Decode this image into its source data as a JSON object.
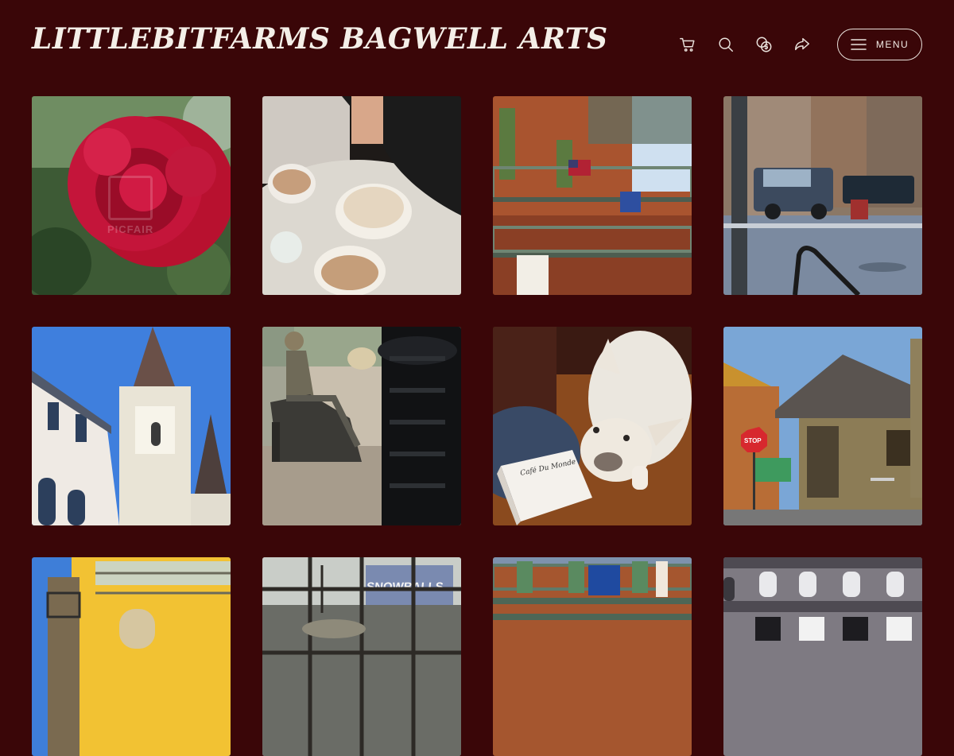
{
  "header": {
    "site_title": "LittleBitFarms Bagwell Arts",
    "menu_label": "MENU",
    "icons": [
      "cart-icon",
      "search-icon",
      "currency-icon",
      "share-icon",
      "hamburger-icon"
    ]
  },
  "colors": {
    "background": "#3a0608",
    "text": "#f4efe8"
  },
  "gallery": {
    "items": [
      {
        "subject": "red-rose",
        "watermark": "PICFAIR"
      },
      {
        "subject": "cafe-beignets"
      },
      {
        "subject": "balcony-flags"
      },
      {
        "subject": "street-truck"
      },
      {
        "subject": "cathedral-spire"
      },
      {
        "subject": "statue-bench"
      },
      {
        "subject": "bulldog-box",
        "box_text": "Café Du Monde"
      },
      {
        "subject": "corner-building",
        "sign_text": "STOP"
      },
      {
        "subject": "yellow-building"
      },
      {
        "subject": "window-reflection",
        "sign_text": "SNOWBALLS"
      },
      {
        "subject": "balcony-flags-2"
      },
      {
        "subject": "grey-building"
      }
    ]
  }
}
